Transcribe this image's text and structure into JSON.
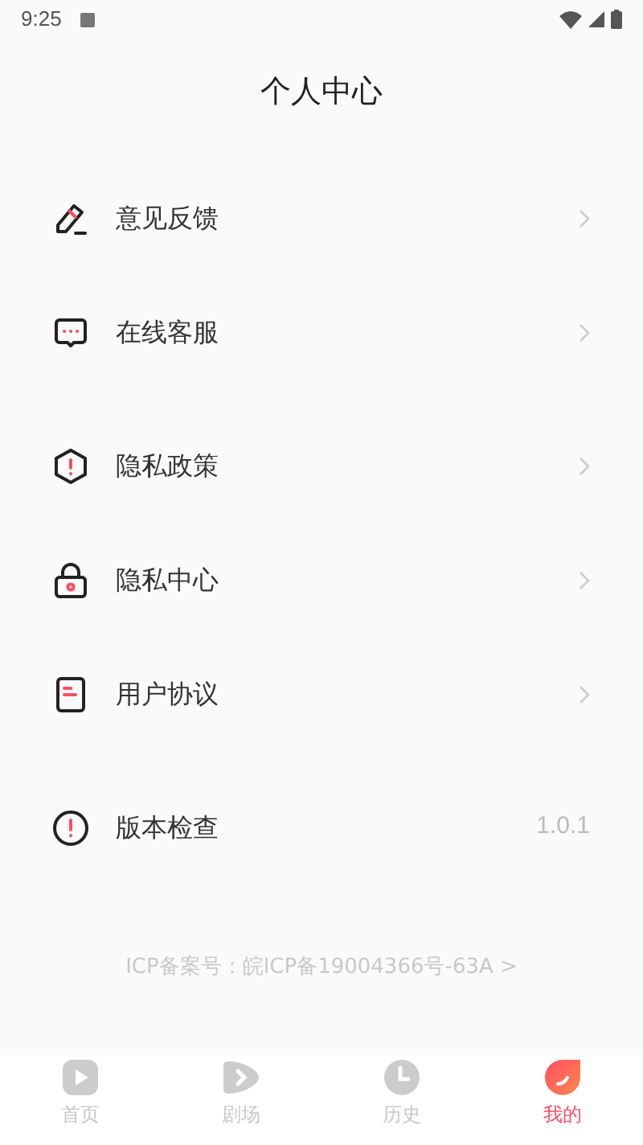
{
  "status_bar": {
    "time": "9:25"
  },
  "header": {
    "title": "个人中心"
  },
  "groups": [
    {
      "items": [
        {
          "label": "意见反馈",
          "kind": "link"
        },
        {
          "label": "在线客服",
          "kind": "link"
        }
      ]
    },
    {
      "items": [
        {
          "label": "隐私政策",
          "kind": "link"
        },
        {
          "label": "隐私中心",
          "kind": "link"
        },
        {
          "label": "用户协议",
          "kind": "link"
        }
      ]
    },
    {
      "items": [
        {
          "label": "版本检查",
          "kind": "value",
          "value": "1.0.1"
        }
      ]
    }
  ],
  "icp": "ICP备案号：皖ICP备19004366号-63A >",
  "tabs": [
    {
      "label": "首页",
      "selected": false
    },
    {
      "label": "剧场",
      "selected": false
    },
    {
      "label": "历史",
      "selected": false
    },
    {
      "label": "我的",
      "selected": true
    }
  ]
}
